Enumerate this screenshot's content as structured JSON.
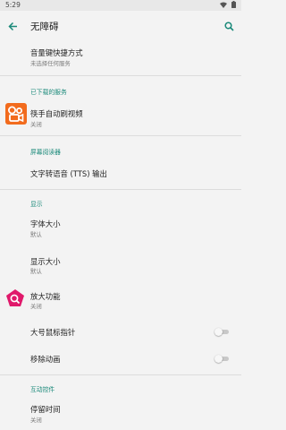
{
  "status": {
    "time": "5:29"
  },
  "appbar": {
    "title": "无障碍"
  },
  "items": {
    "volume_shortcut": {
      "label": "音量键快捷方式",
      "summary": "未选择任何服务"
    },
    "kuaishou": {
      "label": "筷手自动刷视频",
      "summary": "关闭"
    },
    "tts": {
      "label": "文字转语音 (TTS) 输出"
    },
    "font_size": {
      "label": "字体大小",
      "summary": "默认"
    },
    "display_size": {
      "label": "显示大小",
      "summary": "默认"
    },
    "magnification": {
      "label": "放大功能",
      "summary": "关闭"
    },
    "large_pointer": {
      "label": "大号鼠标指针",
      "checked": false
    },
    "remove_animations": {
      "label": "移除动画",
      "checked": false
    },
    "dwell": {
      "label": "停留时间",
      "summary": "关闭"
    }
  },
  "sections": {
    "downloaded": "已下载的服务",
    "screen_reader": "屏幕阅读器",
    "display": "显示",
    "interaction": "互动控件"
  },
  "colors": {
    "accent": "#1b8a7a",
    "kuaishou": "#f26b1d",
    "magnify": "#e0196b"
  }
}
